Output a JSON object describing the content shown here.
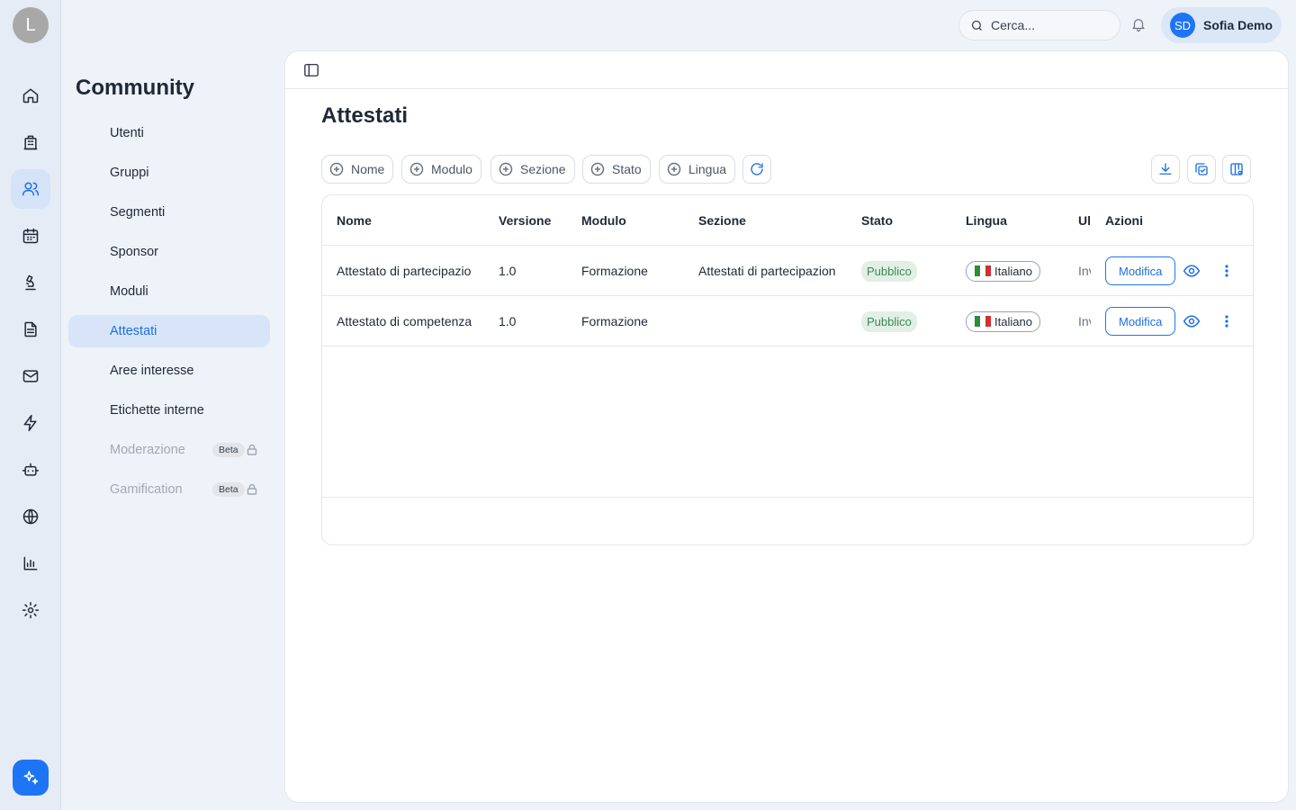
{
  "rail": {
    "logo_letter": "L",
    "items": [
      "home-icon",
      "building-icon",
      "users-icon",
      "calendar-icon",
      "microscope-icon",
      "document-icon",
      "mail-icon",
      "bolt-icon",
      "bot-icon",
      "globe-icon",
      "chart-icon",
      "gear-icon"
    ],
    "active": "users-icon",
    "ai_button": "sparkles-icon"
  },
  "sidebar": {
    "title": "Community",
    "items": [
      {
        "label": "Utenti"
      },
      {
        "label": "Gruppi"
      },
      {
        "label": "Segmenti"
      },
      {
        "label": "Sponsor"
      },
      {
        "label": "Moduli"
      },
      {
        "label": "Attestati",
        "active": true
      },
      {
        "label": "Aree interesse"
      },
      {
        "label": "Etichette interne"
      },
      {
        "label": "Moderazione",
        "badge": "Beta",
        "disabled": true
      },
      {
        "label": "Gamification",
        "badge": "Beta",
        "disabled": true
      }
    ]
  },
  "header": {
    "search_placeholder": "Cerca...",
    "user": {
      "initials": "SD",
      "name": "Sofia Demo"
    }
  },
  "main": {
    "title": "Attestati",
    "filters": [
      "Nome",
      "Modulo",
      "Sezione",
      "Stato",
      "Lingua"
    ],
    "toolbar_icons": [
      "refresh-icon",
      "download-icon",
      "copy-check-icon",
      "columns-settings-icon"
    ],
    "table": {
      "columns": [
        "Nome",
        "Versione",
        "Modulo",
        "Sezione",
        "Stato",
        "Lingua",
        "Ul",
        "Azioni"
      ],
      "rows": [
        {
          "nome": "Attestato di partecipazio",
          "versione": "1.0",
          "modulo": "Formazione",
          "sezione": "Attestati di partecipazion",
          "stato": "Pubblico",
          "lingua": "Italiano",
          "ul": "Inv",
          "azione": "Modifica"
        },
        {
          "nome": "Attestato di competenza",
          "versione": "1.0",
          "modulo": "Formazione",
          "sezione": "",
          "stato": "Pubblico",
          "lingua": "Italiano",
          "ul": "Inv",
          "azione": "Modifica"
        }
      ]
    }
  },
  "colors": {
    "accent": "#1d74f5",
    "active_bg": "#d8e5f8",
    "success_text": "#3c8a55",
    "success_bg": "#e2efe5"
  }
}
